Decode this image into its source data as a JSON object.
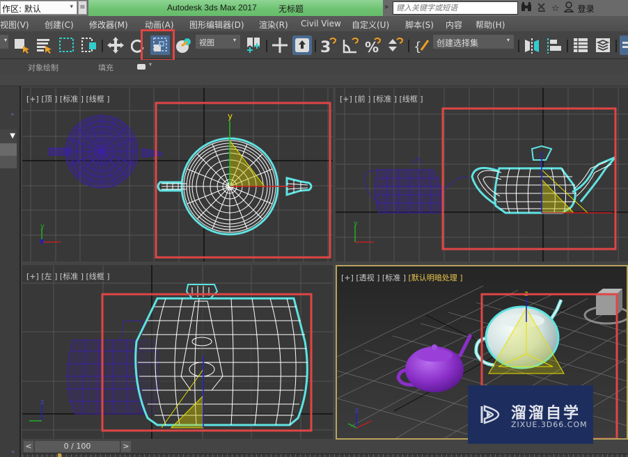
{
  "titlebar": {
    "workspace_label": "作区: 默认",
    "app_title": "Autodesk 3ds Max 2017",
    "document_title": "无标题",
    "search_placeholder": "键入关键字或短语",
    "login_label": "登录",
    "icons": [
      "binoculars-icon",
      "satellite-icon",
      "star-icon",
      "user-icon"
    ]
  },
  "menubar": {
    "items": [
      {
        "label": "视图(V)"
      },
      {
        "label": "创建(C)"
      },
      {
        "label": "修改器(M)"
      },
      {
        "label": "动画(A)"
      },
      {
        "label": "图形编辑器(D)"
      },
      {
        "label": "渲染(R)"
      },
      {
        "label": "Civil View"
      },
      {
        "label": "自定义(U)"
      },
      {
        "label": "脚本(S)"
      },
      {
        "label": "内容"
      },
      {
        "label": "帮助(H)"
      }
    ]
  },
  "toolbar": {
    "coord_dropdown": "视图",
    "selection_set_dropdown": "创建选择集",
    "highlighted_tool": "window-crossing-toggle",
    "highlight_color": "#e04545"
  },
  "ribbon": {
    "tab_object_paint": "对象绘制",
    "tab_populate": "填充"
  },
  "viewports": [
    {
      "id": "top",
      "plus": "[+]",
      "view": "[顶 ]",
      "shading_mode": "[标准 ]",
      "render_mode": "[线框 ]"
    },
    {
      "id": "front",
      "plus": "[+]",
      "view": "[前 ]",
      "shading_mode": "[标准 ]",
      "render_mode": "[线框 ]"
    },
    {
      "id": "left",
      "plus": "[+]",
      "view": "[左 ]",
      "shading_mode": "[标准 ]",
      "render_mode": "[线框 ]"
    },
    {
      "id": "perspective",
      "plus": "[+]",
      "view": "[透视 ]",
      "shading_mode": "[标准 ]",
      "render_mode": "[默认明暗处理 ]",
      "active": true
    }
  ],
  "axes": {
    "x": "x",
    "y": "y",
    "z": "z"
  },
  "colors": {
    "selection_box": "#e04545",
    "selected_outline": "#5fe3e3",
    "unselected_wire": "#3a1fa8",
    "teapot_purple": "#8a2fc8",
    "active_border": "#b8a35c",
    "label_yellow": "#e8c54a"
  },
  "timeline": {
    "prev": "<",
    "next": ">",
    "frame_display": "0 / 100"
  },
  "watermark": {
    "title": "溜溜自学",
    "url": "ZIXUE.3D66.COM"
  }
}
